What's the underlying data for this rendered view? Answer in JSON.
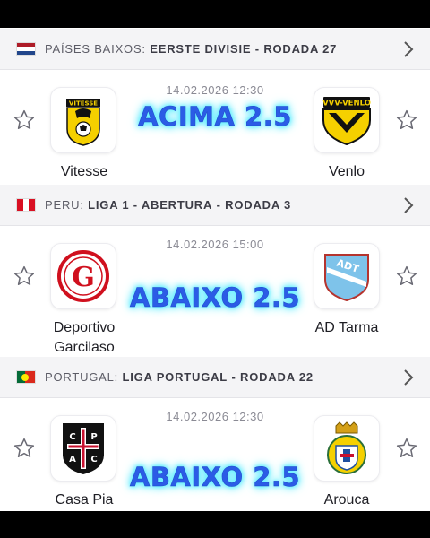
{
  "sections": [
    {
      "league": {
        "country": "PAÍSES BAIXOS:",
        "name": "EERSTE DIVISIE",
        "round": "RODADA 27",
        "separator": "-"
      },
      "datetime": "14.02.2026 12:30",
      "home": {
        "name": "Vitesse",
        "logo_text": "VITESSE"
      },
      "away": {
        "name": "Venlo",
        "logo_text": "VVV-VENLO"
      },
      "tip": "ACIMA 2.5"
    },
    {
      "league": {
        "country": "PERU:",
        "name": "LIGA 1 - ABERTURA",
        "round": "RODADA 3",
        "separator": "-"
      },
      "datetime": "14.02.2026 15:00",
      "home": {
        "name_line1": "Deportivo",
        "name_line2": "Garcilaso",
        "logo_text": "G"
      },
      "away": {
        "name": "AD Tarma",
        "logo_text": "ADT"
      },
      "tip": "ABAIXO 2.5"
    },
    {
      "league": {
        "country": "PORTUGAL:",
        "name": "LIGA PORTUGAL",
        "round": "RODADA 22",
        "separator": "-"
      },
      "datetime": "14.02.2026 12:30",
      "home": {
        "name": "Casa Pia",
        "logo_text": "CPAC"
      },
      "away": {
        "name": "Arouca",
        "logo_text": ""
      },
      "tip": "ABAIXO 2.5"
    }
  ],
  "icons": [
    "star-outline-icon",
    "chevron-right-icon",
    "netherlands-flag-icon",
    "peru-flag-icon",
    "portugal-flag-icon"
  ],
  "colors": {
    "tip_blue": "#2b5ce6",
    "tip_glow": "#6ff4ff",
    "header_bg": "#f4f4f6",
    "text_gray": "#8a8a94"
  }
}
